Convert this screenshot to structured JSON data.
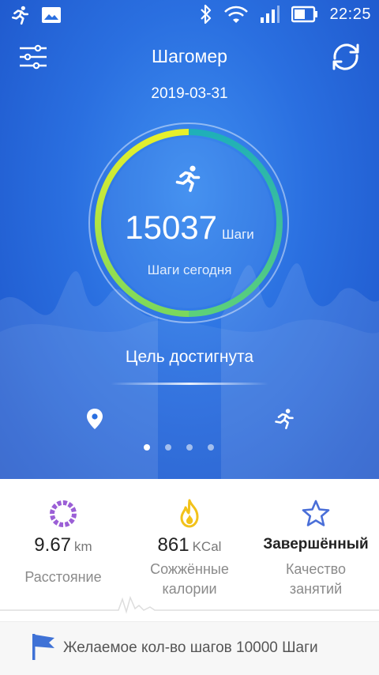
{
  "status_bar": {
    "time": "22:25",
    "icons": [
      "running-app-icon",
      "gallery-icon",
      "bluetooth-icon",
      "wifi-icon",
      "signal-icon",
      "battery-icon"
    ]
  },
  "header": {
    "title": "Шагомер",
    "date": "2019-03-31"
  },
  "steps": {
    "value": "15037",
    "unit": "Шаги",
    "subtitle": "Шаги сегодня",
    "goal_status": "Цель достигнута"
  },
  "pager": {
    "count": 4,
    "active": 1
  },
  "stats": [
    {
      "icon": "distance-ring-icon",
      "value": "9.67",
      "unit": "km",
      "label": "Расстояние"
    },
    {
      "icon": "flame-icon",
      "value": "861",
      "unit": "KCal",
      "label_line1": "Сожжённые",
      "label_line2": "калории"
    },
    {
      "icon": "star-icon",
      "value": "Завершённый",
      "label_line1": "Качество",
      "label_line2": "занятий"
    }
  ],
  "footer": {
    "text": "Желаемое кол-во шагов 10000 Шаги"
  },
  "colors": {
    "hero_blue": "#2a6fe0",
    "ring_yellow": "#e8f02a",
    "ring_teal": "#1fb0b8",
    "ring_green": "#7bd85c",
    "distance_purple": "#9b5fd6",
    "flame_yellow": "#f2c21a",
    "star_blue": "#4a6fd8",
    "flag_blue": "#3f72d6"
  }
}
